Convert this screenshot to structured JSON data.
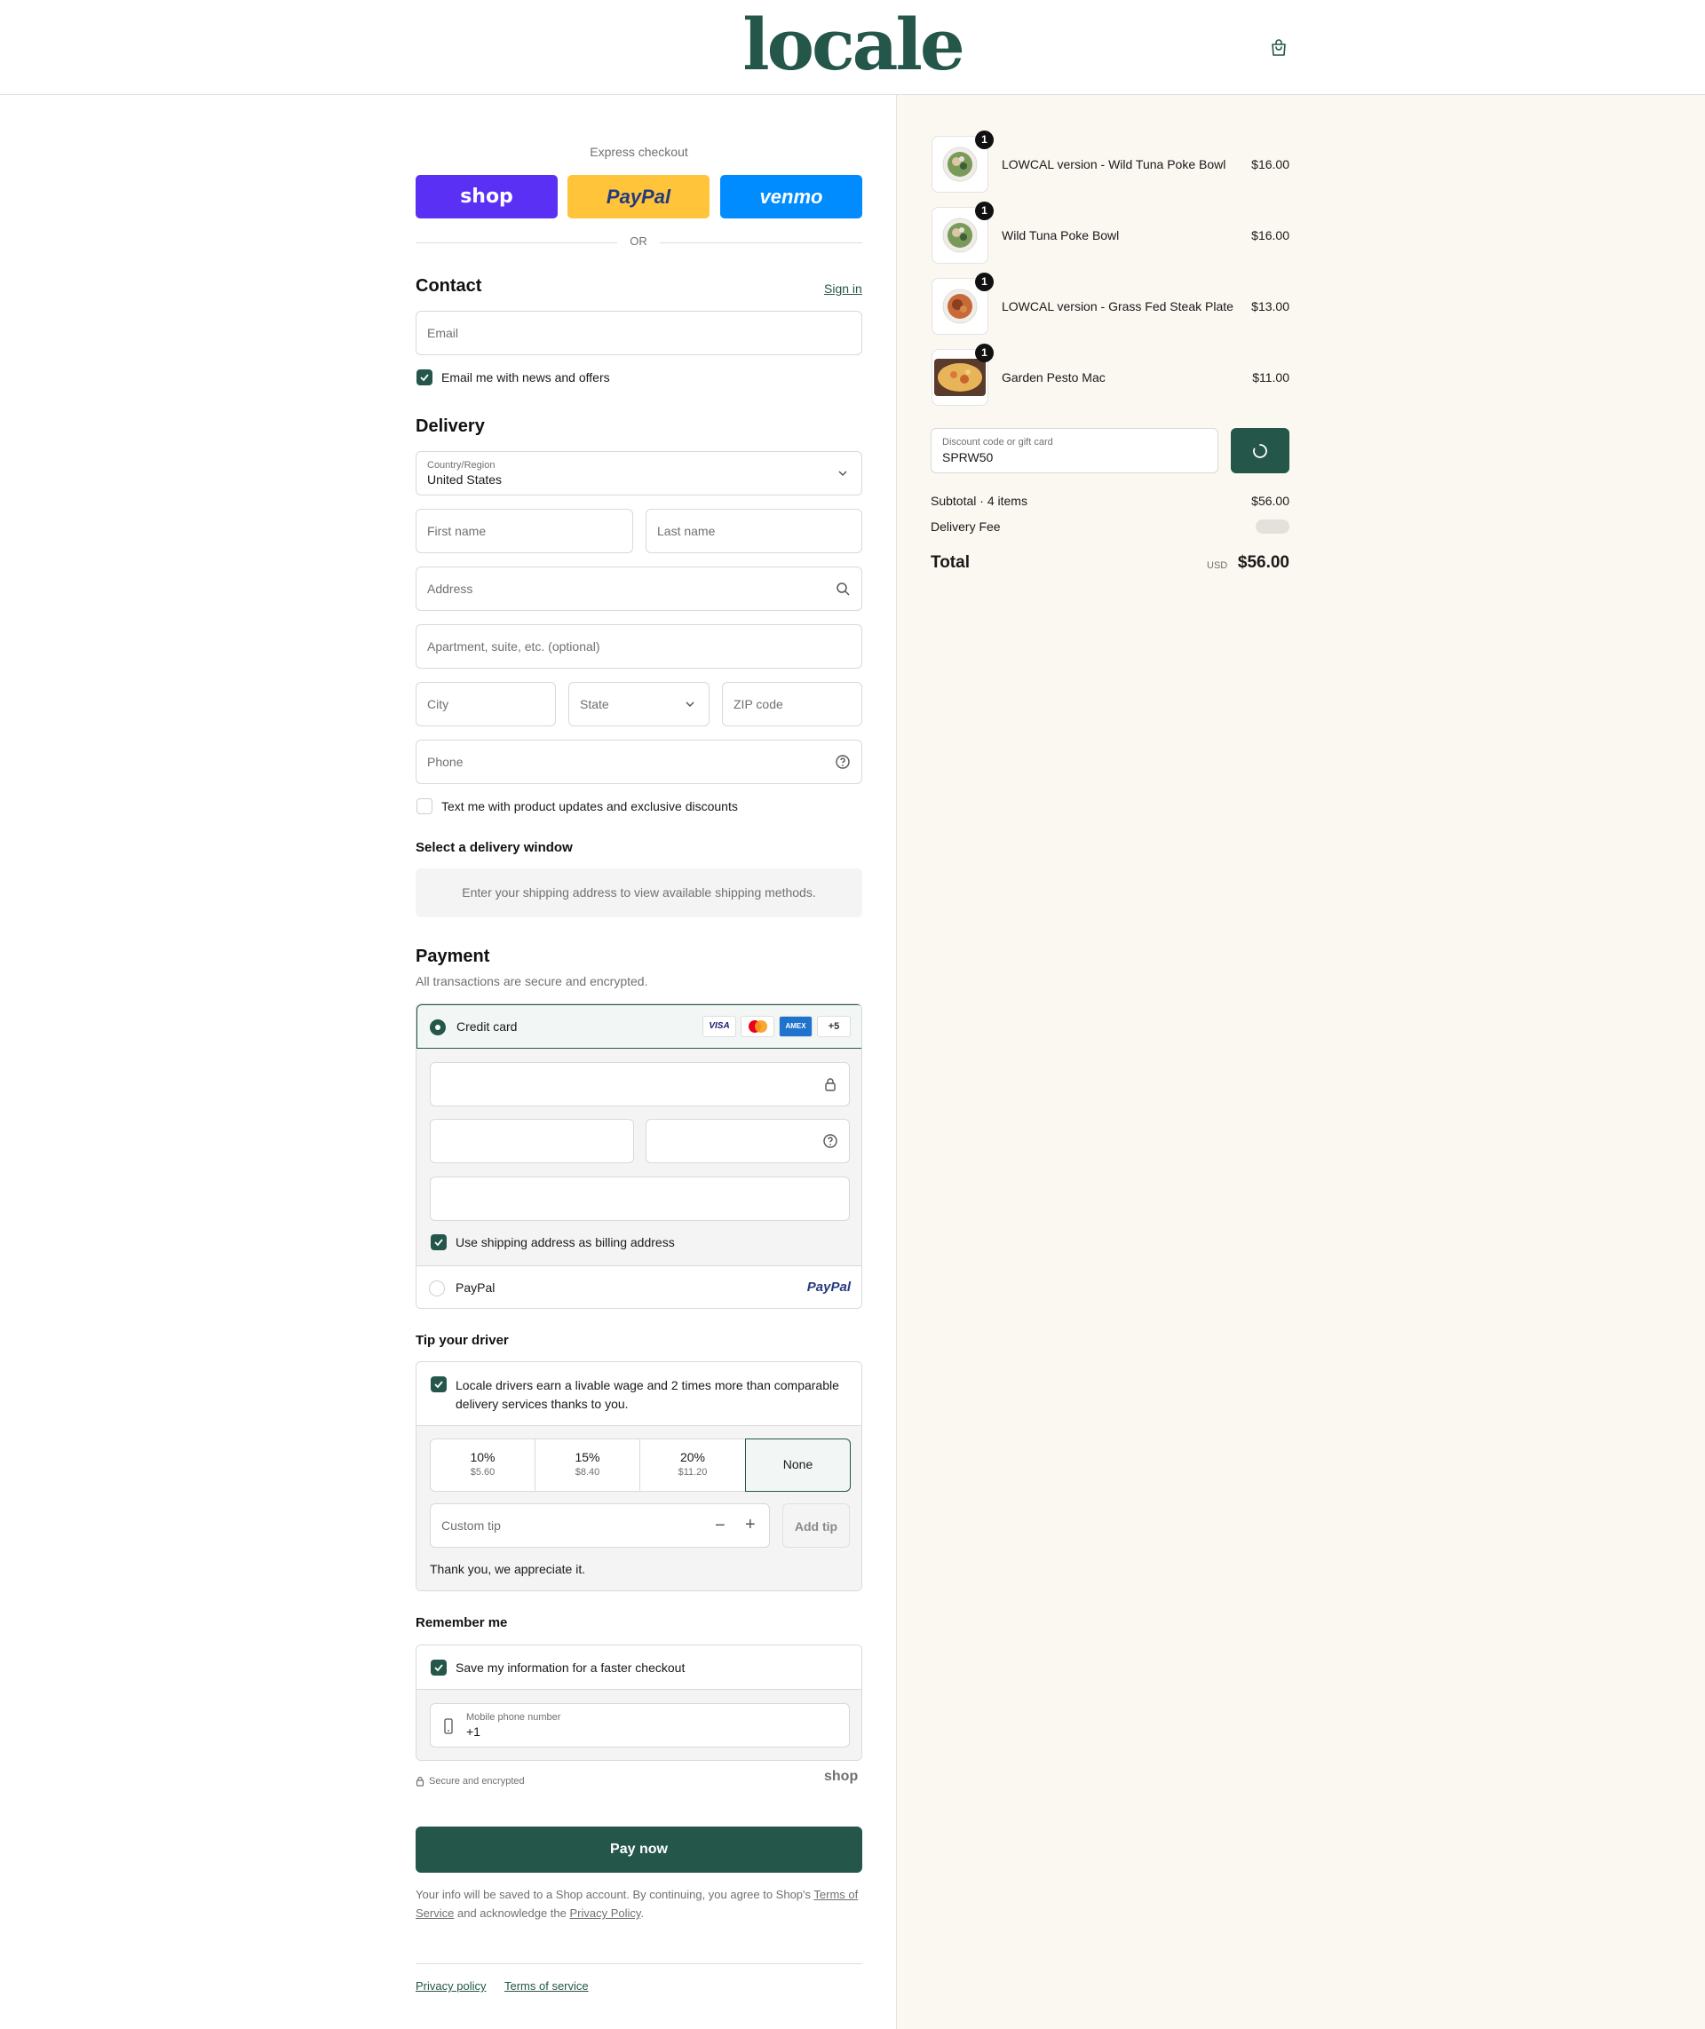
{
  "header": {
    "logo": "locale",
    "cart_icon": "shopping-bag-icon"
  },
  "express": {
    "title": "Express checkout",
    "shop_label": "shop",
    "paypal_label": "PayPal",
    "venmo_label": "venmo",
    "or_label": "OR"
  },
  "contact": {
    "title": "Contact",
    "sign_in": "Sign in",
    "email_placeholder": "Email",
    "news_checkbox": "Email me with news and offers"
  },
  "delivery": {
    "title": "Delivery",
    "country_label": "Country/Region",
    "country_value": "United States",
    "first_name": "First name",
    "last_name": "Last name",
    "address": "Address",
    "apartment": "Apartment, suite, etc. (optional)",
    "city": "City",
    "state": "State",
    "zip": "ZIP code",
    "phone": "Phone",
    "sms_checkbox": "Text me with product updates and exclusive discounts",
    "window_title": "Select a delivery window",
    "window_notice": "Enter your shipping address to view available shipping methods."
  },
  "payment": {
    "title": "Payment",
    "subtitle": "All transactions are secure and encrypted.",
    "credit_card": "Credit card",
    "brands": [
      "VISA",
      "AMEX",
      "+5"
    ],
    "billing_checkbox": "Use shipping address as billing address",
    "paypal": "PayPal",
    "paypal_logo": "PayPal"
  },
  "tip": {
    "title": "Tip your driver",
    "notice": "Locale drivers earn a livable wage and 2 times more than comparable delivery services thanks to you.",
    "options": [
      {
        "pct": "10%",
        "amt": "$5.60"
      },
      {
        "pct": "15%",
        "amt": "$8.40"
      },
      {
        "pct": "20%",
        "amt": "$11.20"
      },
      {
        "pct": "None",
        "amt": ""
      }
    ],
    "selected": "None",
    "custom_placeholder": "Custom tip",
    "add_tip": "Add tip",
    "thanks": "Thank you, we appreciate it."
  },
  "remember": {
    "title": "Remember me",
    "save_checkbox": "Save my information for a faster checkout",
    "phone_label": "Mobile phone number",
    "phone_value": "+1",
    "secure": "Secure and encrypted",
    "shop_logo": "shop"
  },
  "pay_now": "Pay now",
  "legal": {
    "text1": "Your info will be saved to a Shop account. By continuing, you agree to Shop's",
    "terms": "Terms of Service",
    "text2": "and acknowledge the",
    "privacy": "Privacy Policy",
    "period": "."
  },
  "footer": {
    "privacy": "Privacy policy",
    "terms": "Terms of service"
  },
  "summary": {
    "items": [
      {
        "name": "LOWCAL version - Wild Tuna Poke Bowl",
        "price": "$16.00",
        "qty": "1"
      },
      {
        "name": "Wild Tuna Poke Bowl",
        "price": "$16.00",
        "qty": "1"
      },
      {
        "name": "LOWCAL version - Grass Fed Steak Plate",
        "price": "$13.00",
        "qty": "1"
      },
      {
        "name": "Garden Pesto Mac",
        "price": "$11.00",
        "qty": "1"
      }
    ],
    "discount_label": "Discount code or gift card",
    "discount_value": "SPRW50",
    "subtotal_label": "Subtotal · 4 items",
    "subtotal_value": "$56.00",
    "delivery_label": "Delivery Fee",
    "total_label": "Total",
    "currency": "USD",
    "total_value": "$56.00"
  },
  "colors": {
    "brand": "#24564a",
    "shop": "#5a31f4",
    "paypal": "#ffc439",
    "venmo": "#008cff",
    "panel": "#fbf7f1"
  }
}
